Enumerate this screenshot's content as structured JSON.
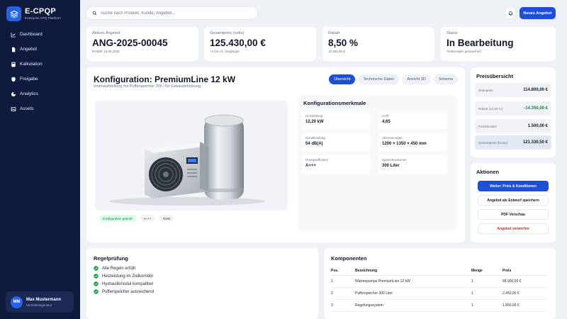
{
  "app": {
    "name": "E-CPQP",
    "subtitle": "Enterprise CPQ Plattform"
  },
  "nav": [
    {
      "label": "Dashboard",
      "icon": "chart-icon"
    },
    {
      "label": "Angebot",
      "icon": "document-icon"
    },
    {
      "label": "Kalkulation",
      "icon": "calculator-icon"
    },
    {
      "label": "Freigabe",
      "icon": "shield-icon"
    },
    {
      "label": "Analytics",
      "icon": "analytics-icon"
    },
    {
      "label": "Assets",
      "icon": "image-icon"
    }
  ],
  "user": {
    "initials": "MM",
    "name": "Max Mustermann",
    "role": "Vertriebsingenieur"
  },
  "search": {
    "placeholder": "Suche nach Produkt, Kunde, Angebot..."
  },
  "header": {
    "new_button": "Neues Angebot"
  },
  "kpis": [
    {
      "label": "Aktives Angebot",
      "value": "ANG-2025-00045",
      "sub": "Erstellt: 15.05.2025"
    },
    {
      "label": "Gesamtpreis (netto)",
      "value": "125.430,00 €",
      "sub": "+4,2% vs. Vorgänger"
    },
    {
      "label": "Rabatt",
      "value": "8,50 %",
      "sub": "10.350,00 €"
    },
    {
      "label": "Status",
      "value": "In Bearbeitung",
      "sub": "Änderungen gespeichert"
    }
  ],
  "config": {
    "title": "Konfiguration: PremiumLine 12 kW",
    "subtitle": "Innenaufstellung mit Pufferspeicher 300 l für Gebäudeheizung.",
    "tabs": [
      "Übersicht",
      "Technische Daten",
      "Ansicht 3D",
      "Schema"
    ],
    "active_tab": 0,
    "badges": [
      "Konfiguration geprüft",
      "A+++",
      "R290"
    ],
    "props_title": "Konfigurationsmerkmale",
    "props": [
      {
        "label": "Heizleistung",
        "value": "12,20 kW"
      },
      {
        "label": "COP",
        "value": "4,65"
      },
      {
        "label": "Schallleistung",
        "value": "54 dB(A)"
      },
      {
        "label": "Abmessungen",
        "value": "1200 × 1350 × 450 mm"
      },
      {
        "label": "Energieeffizienz",
        "value": "A+++"
      },
      {
        "label": "Speichervolumen",
        "value": "300 Liter"
      }
    ]
  },
  "price": {
    "title": "Preisübersicht",
    "rows": [
      {
        "label": "Nettopreis",
        "value": "114.800,00 €"
      },
      {
        "label": "Rabatt (12,50 %)",
        "value": "-14.350,00 €"
      },
      {
        "label": "Frachtkosten",
        "value": "1.500,00 €"
      },
      {
        "label": "Gesamtpreis (brutto)",
        "value": "121.330,50 €"
      }
    ]
  },
  "actions": {
    "title": "Aktionen",
    "buttons": [
      "Weiter: Preis & Konditionen",
      "Angebot als Entwurf speichern",
      "PDF Vorschau",
      "Angebot verwerfen"
    ]
  },
  "rules": {
    "title": "Regelprüfung",
    "items": [
      "Alle Regeln erfüllt",
      "Heizleistung im Zielkorridor",
      "Hydraulikmodul kompatibel",
      "Pufferspeicher ausreichend"
    ]
  },
  "components": {
    "title": "Komponenten",
    "headers": [
      "Pos.",
      "Bezeichnung",
      "Menge",
      "Preis"
    ],
    "rows": [
      [
        "1",
        "Wärmepumpe PremiumLine 12 kW",
        "1",
        "68.900,00 €"
      ],
      [
        "2",
        "Pufferspeicher 300 Liter",
        "1",
        "2.450,00 €"
      ],
      [
        "3",
        "Regelungssystem",
        "1",
        "1.850,00 €"
      ]
    ]
  },
  "colors": {
    "sidebar": "#0f1b3d",
    "accent": "#1d4ed8",
    "success": "#15803d",
    "danger": "#dc2626"
  }
}
